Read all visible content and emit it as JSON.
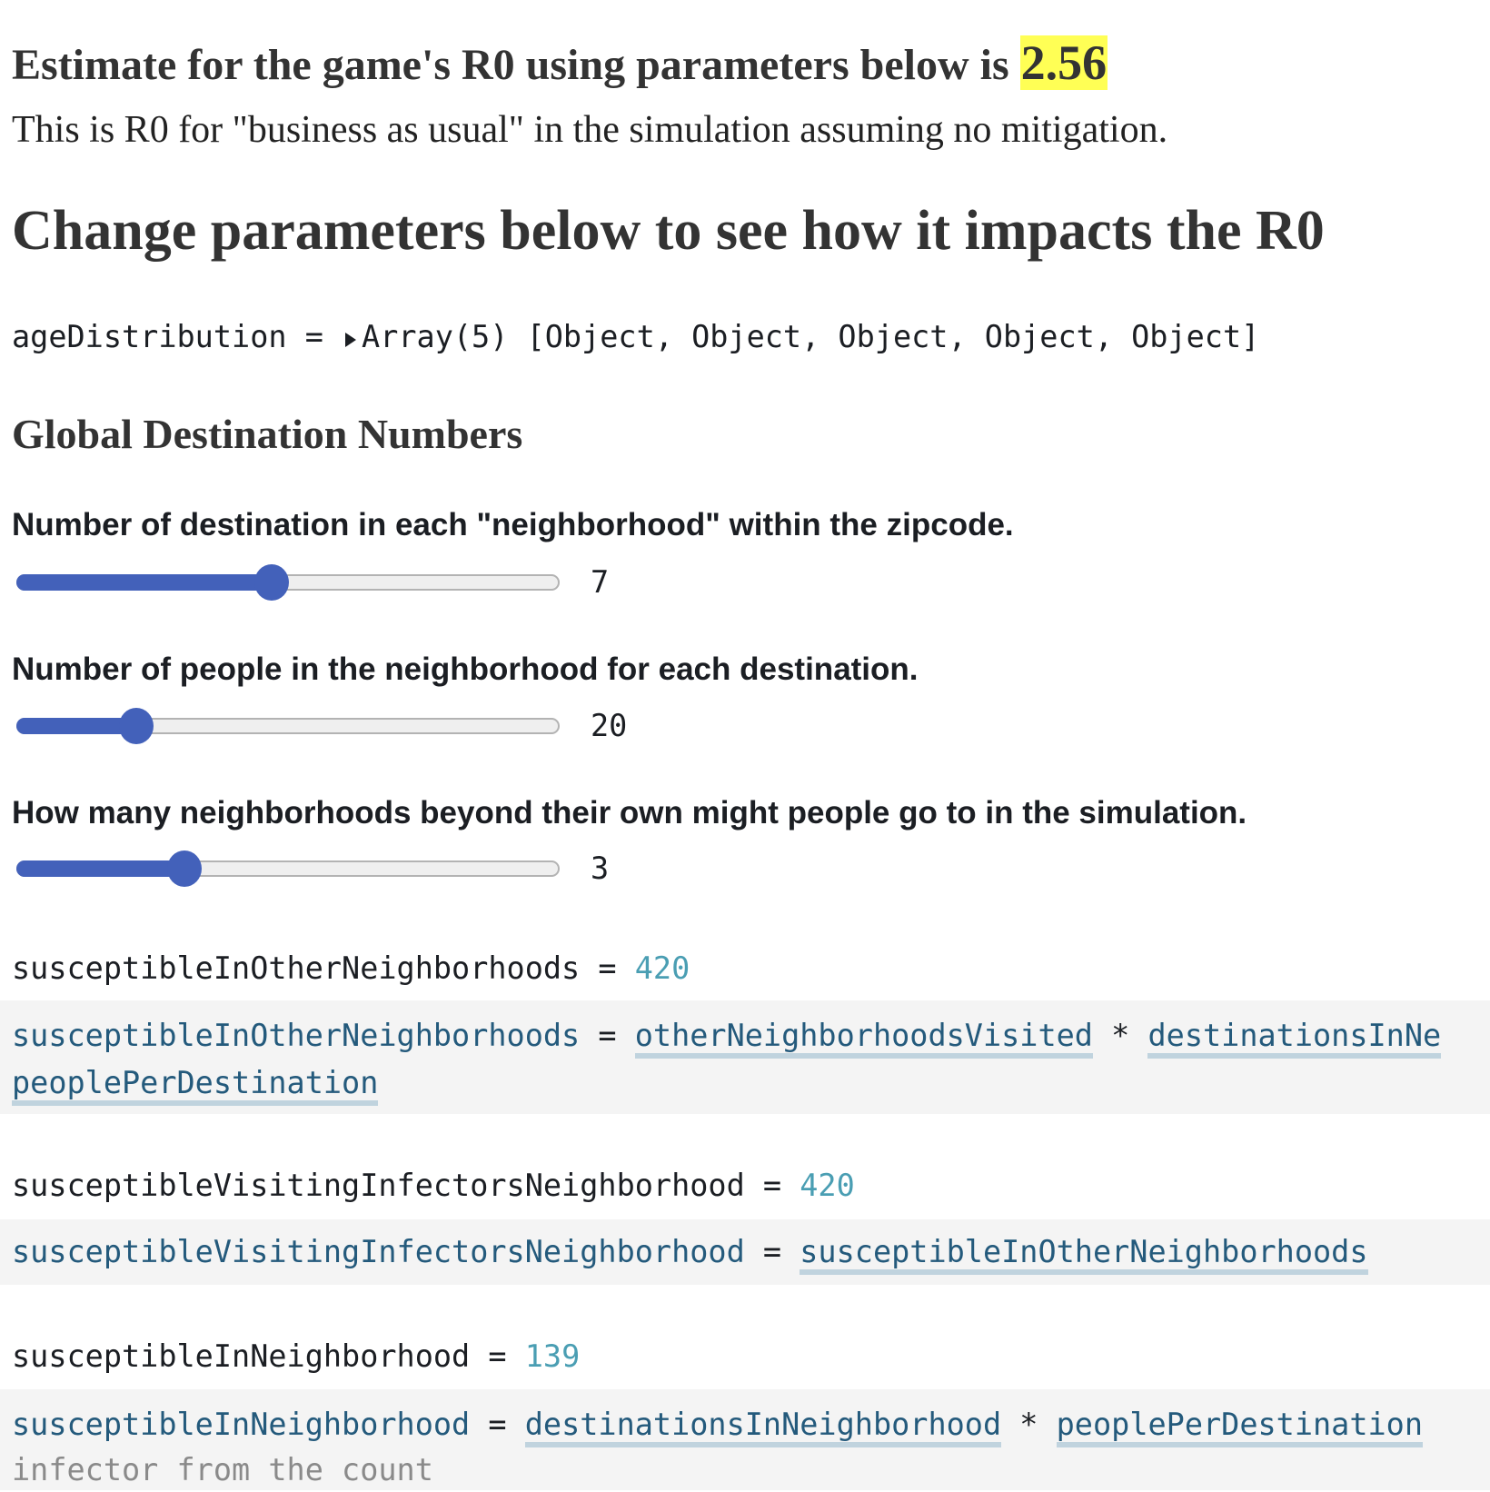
{
  "header": {
    "title_prefix": "Estimate for the game's R0 using parameters below is",
    "r0_value": "2.56",
    "subtitle": "This is R0 for \"business as usual\" in the simulation assuming no mitigation.",
    "section_title": "Change parameters below to see how it impacts the R0"
  },
  "age_distribution": {
    "name": "ageDistribution",
    "eq": "=",
    "summary": "Array(5) [Object, Object, Object, Object, Object]"
  },
  "global_section_title": "Global Destination Numbers",
  "sliders": [
    {
      "label": "Number of destination in each \"neighborhood\" within the zipcode.",
      "value": "7",
      "fill_fraction": 0.47
    },
    {
      "label": "Number of people in the neighborhood for each destination.",
      "value": "20",
      "fill_fraction": 0.22
    },
    {
      "label": "How many neighborhoods beyond their own might people go to in the simulation.",
      "value": "3",
      "fill_fraction": 0.31
    }
  ],
  "cells": [
    {
      "name": "susceptibleInOtherNeighborhoods",
      "eq": "=",
      "value": "420",
      "code_refs": [
        "otherNeighborhoodsVisited",
        "*",
        "destinationsInNe",
        "peoplePerDestination"
      ]
    },
    {
      "name": "susceptibleVisitingInfectorsNeighborhood",
      "eq": "=",
      "value": "420",
      "code_refs": [
        "susceptibleInOtherNeighborhoods"
      ]
    },
    {
      "name": "susceptibleInNeighborhood",
      "eq": "=",
      "value": "139",
      "code_refs": [
        "destinationsInNeighborhood",
        "*",
        "peoplePerDestination"
      ],
      "comment": "infector from the count"
    }
  ],
  "colors": {
    "highlight": "#ffff55",
    "slider": "#4361ba",
    "number": "#4a9eb3",
    "link": "#245a7c"
  }
}
